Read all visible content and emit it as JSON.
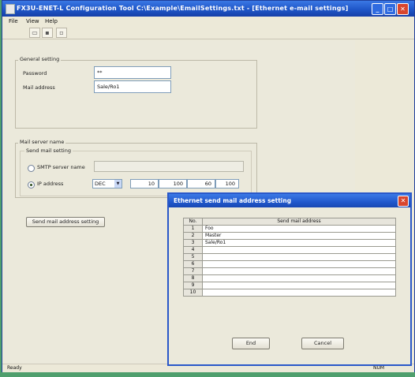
{
  "window": {
    "title": "FX3U-ENET-L Configuration Tool C:\\Example\\EmailSettings.txt - [Ethernet e-mail settings]",
    "minimize_glyph": "_",
    "maximize_glyph": "□",
    "close_glyph": "✕"
  },
  "menu": [
    "File",
    "View",
    "Help"
  ],
  "toolbar": {
    "icons": [
      "open-icon",
      "save-icon",
      "print-icon"
    ]
  },
  "general": {
    "legend": "General setting",
    "password_label": "Password",
    "password_value": "**",
    "mail_label": "Mail address",
    "mail_value": "Sale/Ro1"
  },
  "server": {
    "legend": "Mail server name",
    "send_legend": "Send mail setting",
    "smtp_label": "SMTP server name",
    "ip_label": "IP address",
    "ip_format": "DEC",
    "ip": [
      "10",
      "100",
      "60",
      "100"
    ],
    "selected": "ip"
  },
  "send_button": "Send mail address setting",
  "status": {
    "left": "Ready",
    "right": "NUM"
  },
  "dialog": {
    "title": "Ethernet send mail address setting",
    "col_no": "No.",
    "col_addr": "Send mail address",
    "rows": [
      {
        "no": "1",
        "addr": "Foo"
      },
      {
        "no": "2",
        "addr": "Master"
      },
      {
        "no": "3",
        "addr": "Sale/Ro1"
      },
      {
        "no": "4",
        "addr": ""
      },
      {
        "no": "5",
        "addr": ""
      },
      {
        "no": "6",
        "addr": ""
      },
      {
        "no": "7",
        "addr": ""
      },
      {
        "no": "8",
        "addr": ""
      },
      {
        "no": "9",
        "addr": ""
      },
      {
        "no": "10",
        "addr": ""
      }
    ],
    "end_label": "End",
    "cancel_label": "Cancel"
  }
}
